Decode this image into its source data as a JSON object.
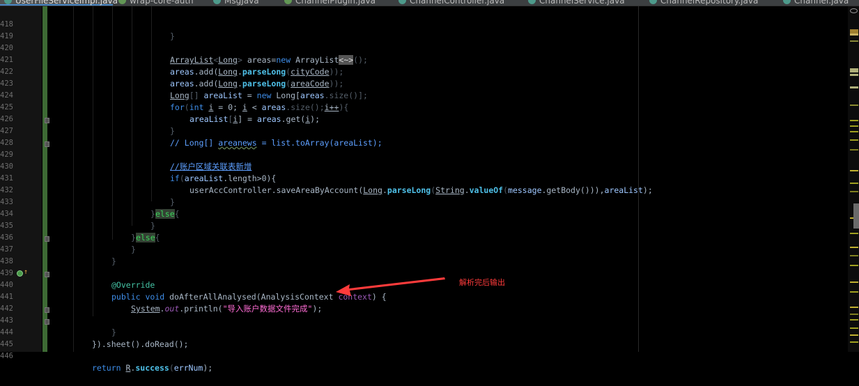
{
  "tabs": [
    {
      "label": "UserFileServiceImpl.java",
      "icon": "java-class-icon",
      "active": true
    },
    {
      "label": "wrap-core-auth",
      "icon": "module-icon",
      "active": false
    },
    {
      "label": "MsgJava",
      "icon": "java-class-icon",
      "active": false
    },
    {
      "label": "ChannelPlugin.java",
      "icon": "java-class-icon",
      "active": false
    },
    {
      "label": "ChannelController.java",
      "icon": "java-class-icon",
      "active": false
    },
    {
      "label": "ChannelService.java",
      "icon": "java-class-icon",
      "active": false
    },
    {
      "label": "ChannelRepository.java",
      "icon": "java-class-icon",
      "active": false
    },
    {
      "label": "Channel.java",
      "icon": "java-class-icon",
      "active": false
    }
  ],
  "line_numbers": [
    "418",
    "419",
    "420",
    "421",
    "422",
    "423",
    "424",
    "425",
    "426",
    "427",
    "428",
    "429",
    "430",
    "431",
    "432",
    "433",
    "434",
    "435",
    "436",
    "437",
    "438",
    "439",
    "440",
    "441",
    "442",
    "443",
    "444",
    "445",
    "446"
  ],
  "code": {
    "l418": "}",
    "l420": {
      "t1": "ArrayList",
      "t2": "<",
      "t3": "Long",
      "t4": ">",
      "t5": " areas=",
      "t6": "new",
      "t7": " ArrayList",
      "t8": "<~>",
      "t9": "();"
    },
    "l421": {
      "a": "areas",
      "b": ".add(",
      "c": "Long",
      "d": ".",
      "e": "parseLong",
      "f": "(",
      "g": "cityCode",
      "h": "));"
    },
    "l422": {
      "a": "areas",
      "b": ".add(",
      "c": "Long",
      "d": ".",
      "e": "parseLong",
      "f": "(",
      "g": "areaCode",
      "h": "));"
    },
    "l423": {
      "a": "Long",
      "b": "[] ",
      "c": "areaList",
      "d": " = ",
      "e": "new",
      "f": " Long[",
      "g": "areas",
      "h": ".size()];"
    },
    "l424": {
      "a": "for",
      "b": "(",
      "c": "int",
      "d": " ",
      "e": "i",
      "f": " = 0; ",
      "g": "i",
      "h": " < ",
      "i": "areas",
      "j": ".size();",
      "k": "i++",
      "l": "){"
    },
    "l425": {
      "a": "areaList",
      "b": "[",
      "c": "i",
      "d": "] = ",
      "e": "areas",
      "f": ".get(",
      "g": "i",
      "h": ");"
    },
    "l426": "}",
    "l427": {
      "a": "// Long[] ",
      "b": "areanews",
      "c": " = list.toArray(areaList);"
    },
    "l429": "//账户区域关联表新增",
    "l430": {
      "a": "if",
      "b": "(",
      "c": "areaList",
      "d": ".length>0){"
    },
    "l431": {
      "a": "userAccController.saveAreaByAccount(",
      "b": "Long",
      "c": ".",
      "d": "parseLong",
      "e": "(",
      "f": "String",
      "g": ".",
      "h": "valueOf",
      "i": "(",
      "j": "message",
      "k": ".getBody())),",
      "l": "areaList",
      "m": ");"
    },
    "l432": "}",
    "l433": {
      "a": "}",
      "b": "else",
      "c": "{"
    },
    "l434": "}",
    "l435": {
      "a": "}",
      "b": "else",
      "c": "{"
    },
    "l436": "}",
    "l437": "}",
    "l439": "@Override",
    "l440": {
      "a": "public",
      "b": " ",
      "c": "void",
      "d": " doAfterAllAnalysed(AnalysisContext ",
      "e": "context",
      "f": ") {"
    },
    "l441": {
      "a": "System",
      "b": ".",
      "c": "out",
      "d": ".println(",
      "e": "\"导入账户数据文件完成\"",
      "f": ");"
    },
    "l443": "}",
    "l444": {
      "a": "}).sheet().doRead();"
    },
    "l446": {
      "a": "return",
      "b": " ",
      "c": "R",
      "d": ".",
      "e": "success",
      "f": "(",
      "g": "errNum",
      "h": ");"
    }
  },
  "annotation": {
    "text": "解析完后输出",
    "color": "#ff3b3b"
  },
  "colors": {
    "background": "#000000",
    "keyword": "#3e8de8",
    "string": "#ff6cd5",
    "annotation_arrow": "#ff3b3b",
    "vcs_bar": "#3d6a34"
  }
}
